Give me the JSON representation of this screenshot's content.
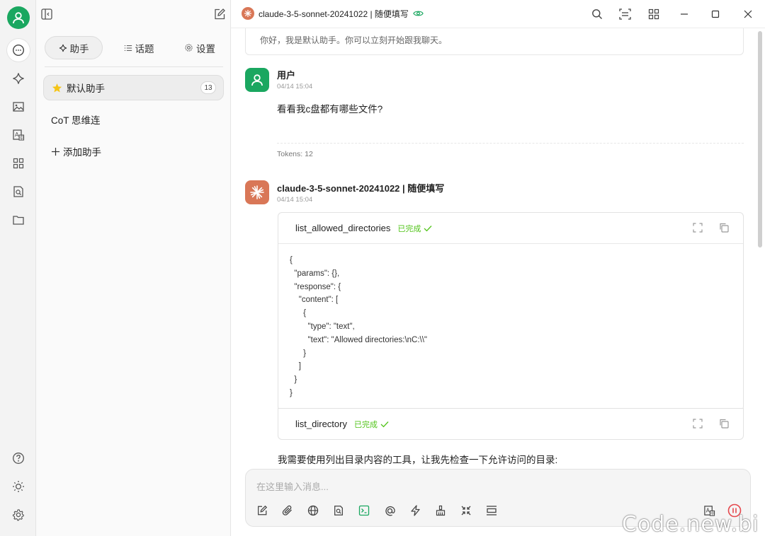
{
  "panel": {
    "tabs": [
      {
        "label": "助手",
        "icon": "sparkle-icon"
      },
      {
        "label": "话题",
        "icon": "list-icon"
      },
      {
        "label": "设置",
        "icon": "gear-icon"
      }
    ],
    "assistants": [
      {
        "label": "默认助手",
        "badge": "13",
        "icon": "star-icon"
      },
      {
        "label": "CoT 思维连"
      }
    ],
    "add_label": "添加助手"
  },
  "topbar": {
    "model": "claude-3-5-sonnet-20241022 | 随便填写"
  },
  "chat": {
    "greeting": "你好，我是默认助手。你可以立刻开始跟我聊天。",
    "user": {
      "name": "用户",
      "time": "04/14 15:04",
      "text": "看看我c盘都有哪些文件?",
      "tokens": "Tokens: 12"
    },
    "assistant": {
      "name": "claude-3-5-sonnet-20241022 | 随便填写",
      "time": "04/14 15:04",
      "tools": [
        {
          "name": "list_allowed_directories",
          "status": "已完成",
          "body": "{\n  \"params\": {},\n  \"response\": {\n    \"content\": [\n      {\n        \"type\": \"text\",\n        \"text\": \"Allowed directories:\\nC:\\\\\"\n      }\n    ]\n  }\n}"
        },
        {
          "name": "list_directory",
          "status": "已完成"
        }
      ],
      "text": "我需要使用列出目录内容的工具，让我先检查一下允许访问的目录:"
    }
  },
  "input": {
    "placeholder": "在这里输入消息..."
  },
  "watermark": "Code.new.bi",
  "colors": {
    "accent": "#1aa760",
    "claude": "#d97757",
    "done": "#52c41a",
    "stop": "#e5484d"
  }
}
